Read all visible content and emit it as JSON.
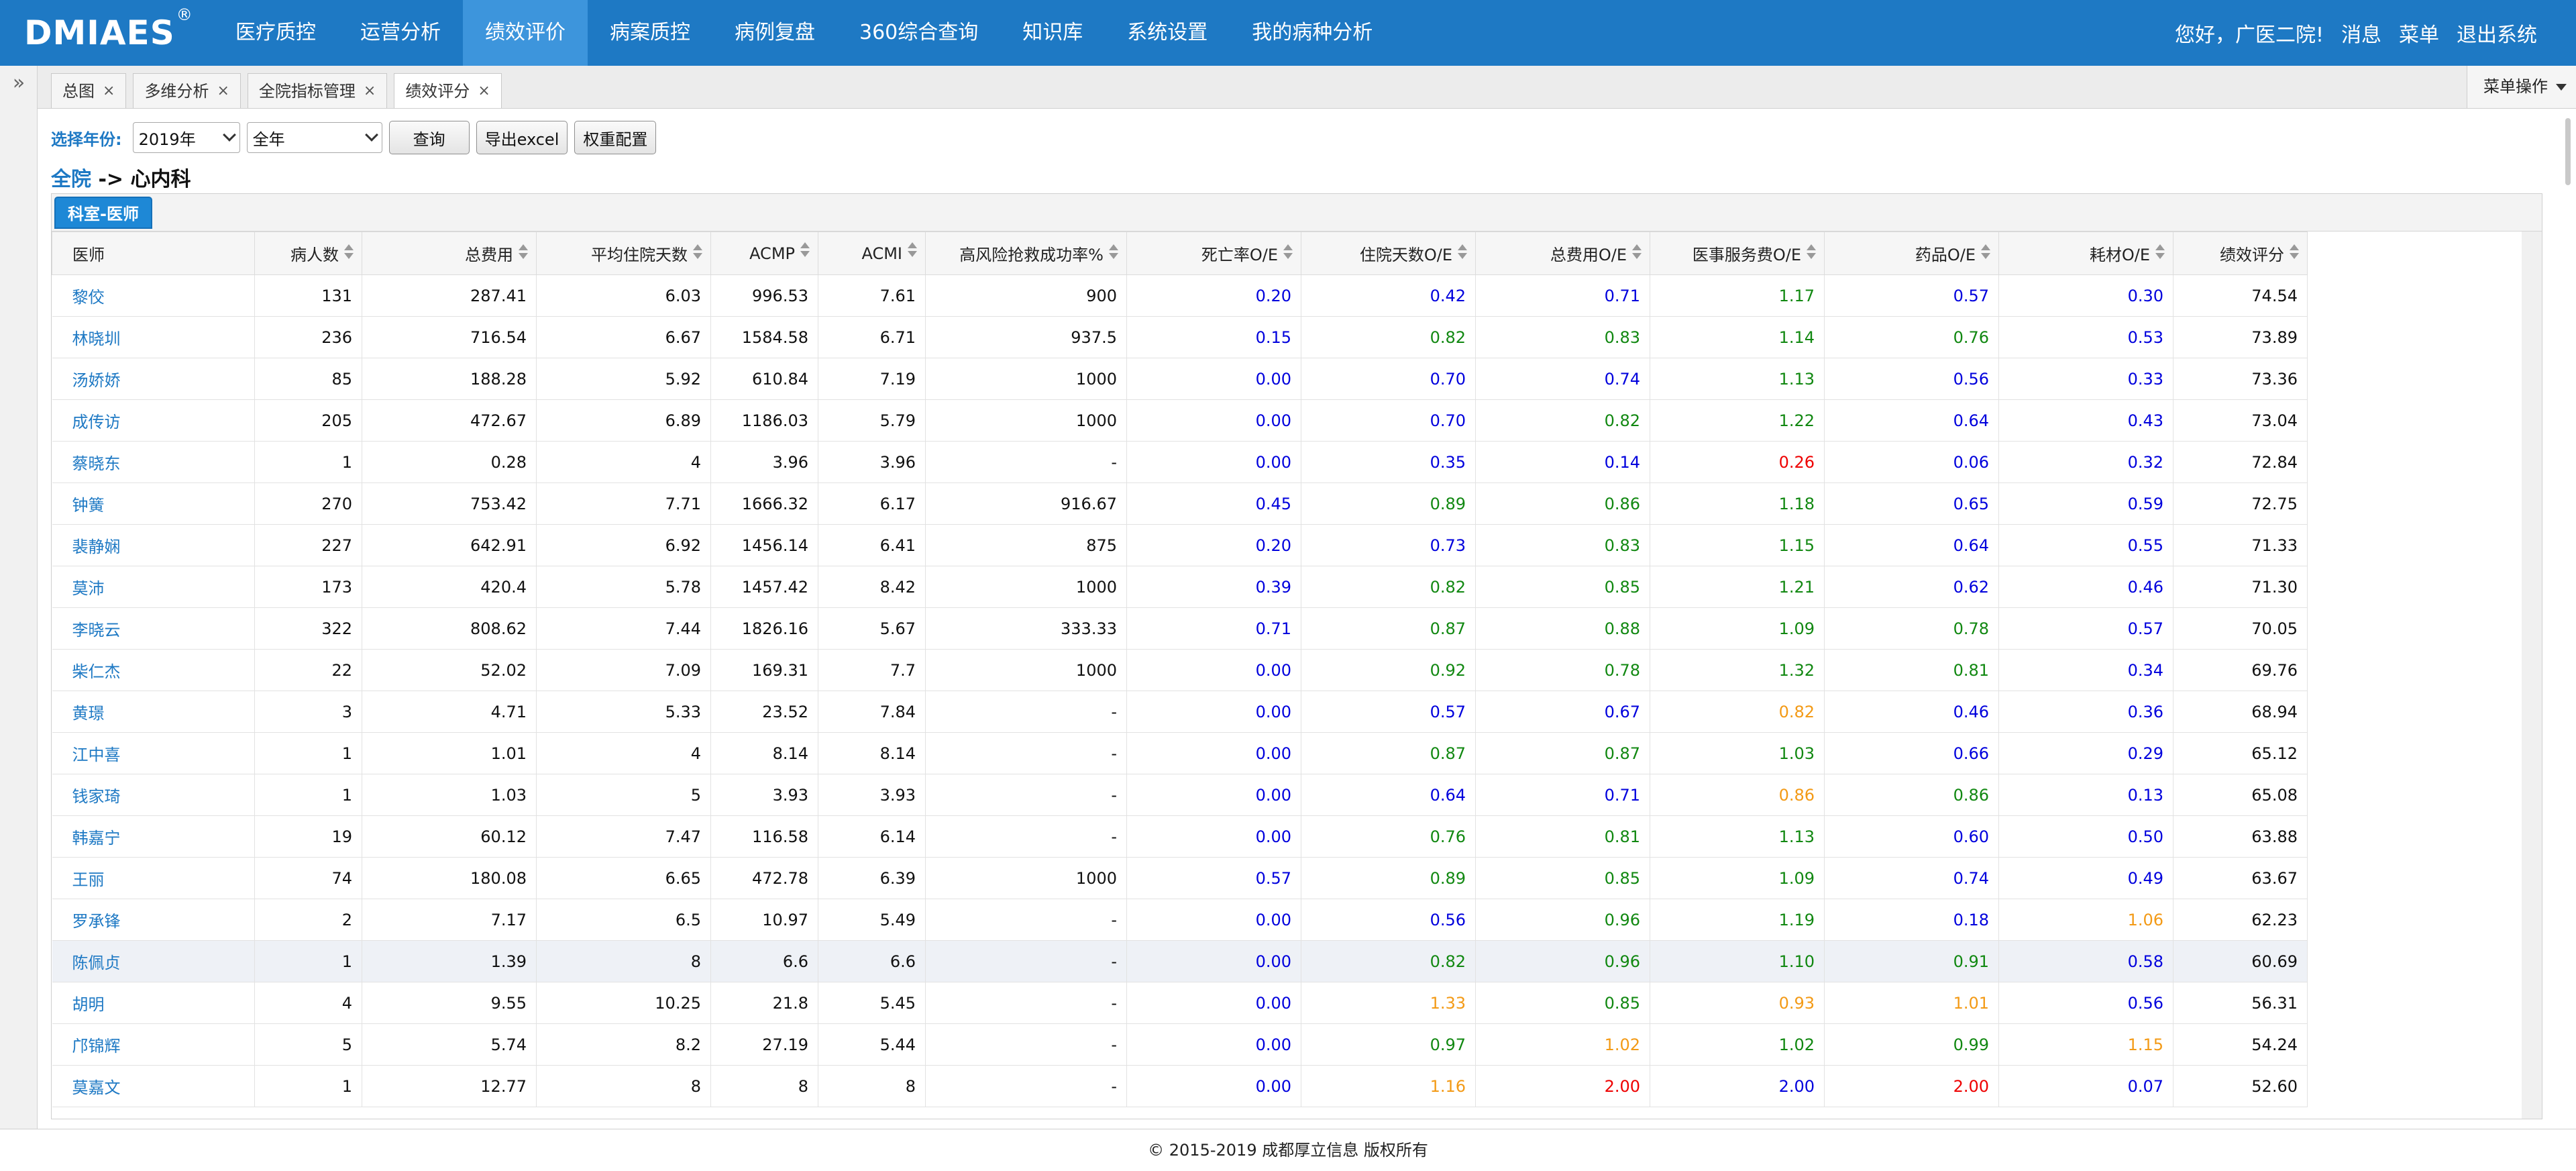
{
  "app": {
    "logo": "DMIAES",
    "logo_mark": "®"
  },
  "nav": {
    "items": [
      {
        "label": "医疗质控",
        "active": false
      },
      {
        "label": "运营分析",
        "active": false
      },
      {
        "label": "绩效评价",
        "active": true
      },
      {
        "label": "病案质控",
        "active": false
      },
      {
        "label": "病例复盘",
        "active": false
      },
      {
        "label": "360综合查询",
        "active": false
      },
      {
        "label": "知识库",
        "active": false
      },
      {
        "label": "系统设置",
        "active": false
      },
      {
        "label": "我的病种分析",
        "active": false
      }
    ],
    "greeting": "您好，广医二院!",
    "messages": "消息",
    "menu": "菜单",
    "logout": "退出系统"
  },
  "tabs": {
    "items": [
      {
        "label": "总图",
        "close": "×",
        "active": false
      },
      {
        "label": "多维分析",
        "close": "×",
        "active": false
      },
      {
        "label": "全院指标管理",
        "close": "×",
        "active": false
      },
      {
        "label": "绩效评分",
        "close": "×",
        "active": true
      }
    ],
    "menu_op": "菜单操作",
    "expand_icon": "»"
  },
  "filters": {
    "year_label": "选择年份:",
    "year_value": "2019年",
    "period_value": "全年",
    "query_button": "查询",
    "export_button": "导出excel",
    "weight_button": "权重配置"
  },
  "breadcrumb": {
    "root": "全院",
    "separator": " -> ",
    "current": "心内科"
  },
  "panel": {
    "tab_label": "科室-医师"
  },
  "table": {
    "headers": [
      "医师",
      "病人数",
      "总费用",
      "平均住院天数",
      "ACMP",
      "ACMI",
      "高风险抢救成功率%",
      "死亡率O/E",
      "住院天数O/E",
      "总费用O/E",
      "医事服务费O/E",
      "药品O/E",
      "耗材O/E",
      "绩效评分"
    ],
    "rows": [
      {
        "cells": [
          "黎佼",
          "131",
          "287.41",
          "6.03",
          "996.53",
          "7.61",
          "900",
          "0.20",
          "0.42",
          "0.71",
          "1.17",
          "0.57",
          "0.30",
          "74.54"
        ],
        "colors": [
          "b",
          "b",
          "b",
          "g",
          "b",
          "b"
        ],
        "highlight": false
      },
      {
        "cells": [
          "林晓圳",
          "236",
          "716.54",
          "6.67",
          "1584.58",
          "6.71",
          "937.5",
          "0.15",
          "0.82",
          "0.83",
          "1.14",
          "0.76",
          "0.53",
          "73.89"
        ],
        "colors": [
          "b",
          "g",
          "g",
          "g",
          "g",
          "b"
        ],
        "highlight": false
      },
      {
        "cells": [
          "汤娇娇",
          "85",
          "188.28",
          "5.92",
          "610.84",
          "7.19",
          "1000",
          "0.00",
          "0.70",
          "0.74",
          "1.13",
          "0.56",
          "0.33",
          "73.36"
        ],
        "colors": [
          "b",
          "b",
          "b",
          "g",
          "b",
          "b"
        ],
        "highlight": false
      },
      {
        "cells": [
          "成传访",
          "205",
          "472.67",
          "6.89",
          "1186.03",
          "5.79",
          "1000",
          "0.00",
          "0.70",
          "0.82",
          "1.22",
          "0.64",
          "0.43",
          "73.04"
        ],
        "colors": [
          "b",
          "b",
          "g",
          "g",
          "b",
          "b"
        ],
        "highlight": false
      },
      {
        "cells": [
          "蔡晓东",
          "1",
          "0.28",
          "4",
          "3.96",
          "3.96",
          "-",
          "0.00",
          "0.35",
          "0.14",
          "0.26",
          "0.06",
          "0.32",
          "72.84"
        ],
        "colors": [
          "b",
          "b",
          "b",
          "r",
          "b",
          "b"
        ],
        "highlight": false
      },
      {
        "cells": [
          "钟簧",
          "270",
          "753.42",
          "7.71",
          "1666.32",
          "6.17",
          "916.67",
          "0.45",
          "0.89",
          "0.86",
          "1.18",
          "0.65",
          "0.59",
          "72.75"
        ],
        "colors": [
          "b",
          "g",
          "g",
          "g",
          "b",
          "b"
        ],
        "highlight": false
      },
      {
        "cells": [
          "裴静娴",
          "227",
          "642.91",
          "6.92",
          "1456.14",
          "6.41",
          "875",
          "0.20",
          "0.73",
          "0.83",
          "1.15",
          "0.64",
          "0.55",
          "71.33"
        ],
        "colors": [
          "b",
          "b",
          "g",
          "g",
          "b",
          "b"
        ],
        "highlight": false
      },
      {
        "cells": [
          "莫沛",
          "173",
          "420.4",
          "5.78",
          "1457.42",
          "8.42",
          "1000",
          "0.39",
          "0.82",
          "0.85",
          "1.21",
          "0.62",
          "0.46",
          "71.30"
        ],
        "colors": [
          "b",
          "g",
          "g",
          "g",
          "b",
          "b"
        ],
        "highlight": false
      },
      {
        "cells": [
          "李晓云",
          "322",
          "808.62",
          "7.44",
          "1826.16",
          "5.67",
          "333.33",
          "0.71",
          "0.87",
          "0.88",
          "1.09",
          "0.78",
          "0.57",
          "70.05"
        ],
        "colors": [
          "b",
          "g",
          "g",
          "g",
          "g",
          "b"
        ],
        "highlight": false
      },
      {
        "cells": [
          "柴仁杰",
          "22",
          "52.02",
          "7.09",
          "169.31",
          "7.7",
          "1000",
          "0.00",
          "0.92",
          "0.78",
          "1.32",
          "0.81",
          "0.34",
          "69.76"
        ],
        "colors": [
          "b",
          "g",
          "g",
          "g",
          "g",
          "b"
        ],
        "highlight": false
      },
      {
        "cells": [
          "黄璟",
          "3",
          "4.71",
          "5.33",
          "23.52",
          "7.84",
          "-",
          "0.00",
          "0.57",
          "0.67",
          "0.82",
          "0.46",
          "0.36",
          "68.94"
        ],
        "colors": [
          "b",
          "b",
          "b",
          "o",
          "b",
          "b"
        ],
        "highlight": false
      },
      {
        "cells": [
          "江中喜",
          "1",
          "1.01",
          "4",
          "8.14",
          "8.14",
          "-",
          "0.00",
          "0.87",
          "0.87",
          "1.03",
          "0.66",
          "0.29",
          "65.12"
        ],
        "colors": [
          "b",
          "g",
          "g",
          "g",
          "b",
          "b"
        ],
        "highlight": false
      },
      {
        "cells": [
          "钱家琦",
          "1",
          "1.03",
          "5",
          "3.93",
          "3.93",
          "-",
          "0.00",
          "0.64",
          "0.71",
          "0.86",
          "0.86",
          "0.13",
          "65.08"
        ],
        "colors": [
          "b",
          "b",
          "b",
          "o",
          "g",
          "b"
        ],
        "highlight": false
      },
      {
        "cells": [
          "韩嘉宁",
          "19",
          "60.12",
          "7.47",
          "116.58",
          "6.14",
          "-",
          "0.00",
          "0.76",
          "0.81",
          "1.13",
          "0.60",
          "0.50",
          "63.88"
        ],
        "colors": [
          "b",
          "g",
          "g",
          "g",
          "b",
          "b"
        ],
        "highlight": false
      },
      {
        "cells": [
          "王丽",
          "74",
          "180.08",
          "6.65",
          "472.78",
          "6.39",
          "1000",
          "0.57",
          "0.89",
          "0.85",
          "1.09",
          "0.74",
          "0.49",
          "63.67"
        ],
        "colors": [
          "b",
          "g",
          "g",
          "g",
          "b",
          "b"
        ],
        "highlight": false
      },
      {
        "cells": [
          "罗承锋",
          "2",
          "7.17",
          "6.5",
          "10.97",
          "5.49",
          "-",
          "0.00",
          "0.56",
          "0.96",
          "1.19",
          "0.18",
          "1.06",
          "62.23"
        ],
        "colors": [
          "b",
          "b",
          "g",
          "g",
          "b",
          "o"
        ],
        "highlight": false
      },
      {
        "cells": [
          "陈佩贞",
          "1",
          "1.39",
          "8",
          "6.6",
          "6.6",
          "-",
          "0.00",
          "0.82",
          "0.96",
          "1.10",
          "0.91",
          "0.58",
          "60.69"
        ],
        "colors": [
          "b",
          "g",
          "g",
          "g",
          "g",
          "b"
        ],
        "highlight": true
      },
      {
        "cells": [
          "胡明",
          "4",
          "9.55",
          "10.25",
          "21.8",
          "5.45",
          "-",
          "0.00",
          "1.33",
          "0.85",
          "0.93",
          "1.01",
          "0.56",
          "56.31"
        ],
        "colors": [
          "b",
          "o",
          "g",
          "o",
          "o",
          "b"
        ],
        "highlight": false
      },
      {
        "cells": [
          "邝锦辉",
          "5",
          "5.74",
          "8.2",
          "27.19",
          "5.44",
          "-",
          "0.00",
          "0.97",
          "1.02",
          "1.02",
          "0.99",
          "1.15",
          "54.24"
        ],
        "colors": [
          "b",
          "g",
          "o",
          "g",
          "g",
          "o"
        ],
        "highlight": false
      },
      {
        "cells": [
          "莫嘉文",
          "1",
          "12.77",
          "8",
          "8",
          "8",
          "-",
          "0.00",
          "1.16",
          "2.00",
          "2.00",
          "2.00",
          "0.07",
          "52.60"
        ],
        "colors": [
          "b",
          "o",
          "r",
          "b",
          "r",
          "b"
        ],
        "highlight": false
      }
    ]
  },
  "footer": {
    "copyright": "© 2015-2019 成都厚立信息 版权所有"
  },
  "colors": {
    "brand": "#1e79c4",
    "nav_active": "#3d95dc",
    "value_blue": "#0000dd",
    "value_green": "#118811",
    "value_orange": "#f39a16",
    "value_red": "#ee0000"
  }
}
